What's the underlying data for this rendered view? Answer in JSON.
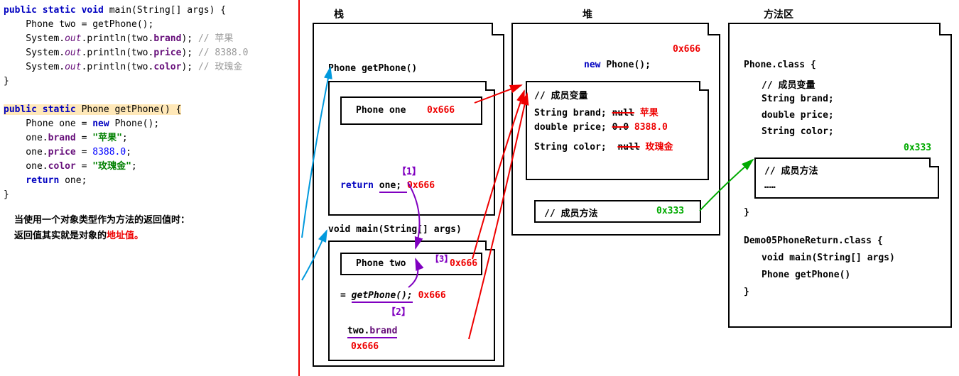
{
  "code": {
    "l1_pre": "public static void ",
    "l1_main": "main(String[] args) {",
    "l2": "    Phone two = getPhone();",
    "l3a": "    System.",
    "l3b": "out",
    "l3c": ".println(two.",
    "l3d": "brand",
    "l3e": "); ",
    "l3cmt": "// 苹果",
    "l4d": "price",
    "l4cmt": "// 8388.0",
    "l5d": "color",
    "l5cmt": "// 玫瑰金",
    "l6": "}",
    "l8a": "public static ",
    "l8b": "Phone getPhone() {",
    "l9a": "    Phone one = ",
    "l9b": "new ",
    "l9c": "Phone();",
    "l10a": "    one.",
    "l10b": "brand",
    "l10c": " = ",
    "l10d": "\"苹果\"",
    "l10e": ";",
    "l11b": "price",
    "l11d": "8388.0",
    "l12b": "color",
    "l12d": "\"玫瑰金\"",
    "l13": "    return ",
    "l13b": "one;",
    "l14": "}"
  },
  "note": {
    "line1": "当使用一个对象类型作为方法的返回值时：",
    "line2a": "返回值其实就是对象的",
    "line2b": "地址值。"
  },
  "labels": {
    "stack": "栈",
    "heap": "堆",
    "method": "方法区"
  },
  "stack": {
    "getPhone": "Phone getPhone()",
    "phoneOne": "Phone one",
    "addr666": "0x666",
    "step1": "【1】",
    "returnOne": "return ",
    "returnOneVar": "one; ",
    "mainSig": "void main(String[] args)",
    "phoneTwo": "Phone two",
    "step3": "【3】",
    "eqGetPhone": "= ",
    "getPhoneCall": "getPhone();",
    "step2": "【2】",
    "twoBrand": "two.",
    "brandWord": "brand"
  },
  "heap": {
    "newPhone": "new ",
    "phoneCall": "Phone();",
    "addr666": "0x666",
    "memberVar": "// 成员变量",
    "stringBrand": "String brand;",
    "nullVal": "null",
    "apple": "苹果",
    "doublePrice": "double price;",
    "zeroVal": "0.0",
    "priceVal": "8388.0",
    "stringColor": "String color;",
    "roseGold": "玫瑰金",
    "memberMethod": "// 成员方法",
    "addr333": "0x333"
  },
  "method_area": {
    "phoneClass": "Phone.class {",
    "memberVar": "// 成员变量",
    "stringBrand": "String brand;",
    "doublePrice": "double price;",
    "stringColor": "String color;",
    "addr333": "0x333",
    "memberMethod": "// 成员方法",
    "dots": "……",
    "closeBrace": "}",
    "demoClass": "Demo05PhoneReturn.class {",
    "mainSig": "void main(String[] args)",
    "getPhoneSig": "Phone getPhone()"
  }
}
